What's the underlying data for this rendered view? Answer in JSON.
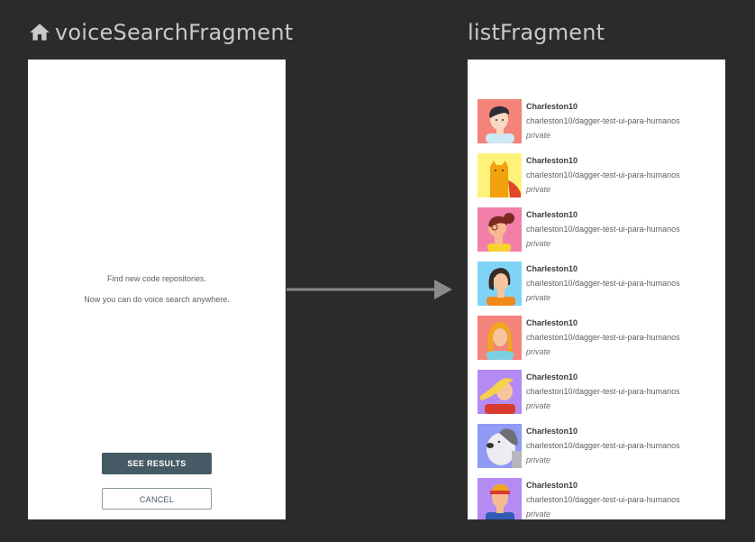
{
  "left_title": "voiceSearchFragment",
  "right_title": "listFragment",
  "voice_screen": {
    "line1": "Find new code repositories.",
    "line2": "Now you can do voice search anywhere.",
    "see_results_label": "SEE RESULTS",
    "cancel_label": "CANCEL"
  },
  "list_items": [
    {
      "name": "Charleston10",
      "repo": "charleston10/dagger-test-ui-para-humanos",
      "visibility": "private",
      "avatar": "boy-dark-hair-avatar",
      "bg": "#f4837a"
    },
    {
      "name": "Charleston10",
      "repo": "charleston10/dagger-test-ui-para-humanos",
      "visibility": "private",
      "avatar": "cat-avatar",
      "bg": "#fff27a"
    },
    {
      "name": "Charleston10",
      "repo": "charleston10/dagger-test-ui-para-humanos",
      "visibility": "private",
      "avatar": "girl-glasses-avatar",
      "bg": "#f27fa9"
    },
    {
      "name": "Charleston10",
      "repo": "charleston10/dagger-test-ui-para-humanos",
      "visibility": "private",
      "avatar": "girl-bob-hair-avatar",
      "bg": "#7fd3f5"
    },
    {
      "name": "Charleston10",
      "repo": "charleston10/dagger-test-ui-para-humanos",
      "visibility": "private",
      "avatar": "girl-blonde-avatar",
      "bg": "#f4837a"
    },
    {
      "name": "Charleston10",
      "repo": "charleston10/dagger-test-ui-para-humanos",
      "visibility": "private",
      "avatar": "blonde-wavy-avatar",
      "bg": "#b48af3"
    },
    {
      "name": "Charleston10",
      "repo": "charleston10/dagger-test-ui-para-humanos",
      "visibility": "private",
      "avatar": "dog-avatar",
      "bg": "#8f9bf5"
    },
    {
      "name": "Charleston10",
      "repo": "charleston10/dagger-test-ui-para-humanos",
      "visibility": "private",
      "avatar": "headband-boy-avatar",
      "bg": "#b48af3"
    }
  ],
  "colors": {
    "background": "#2b2b2d",
    "title_text": "#c9c9c9",
    "primary_button": "#455a64",
    "arrow": "#8a8a8a"
  },
  "icons": [
    "home-icon",
    "arrow-right-icon"
  ]
}
